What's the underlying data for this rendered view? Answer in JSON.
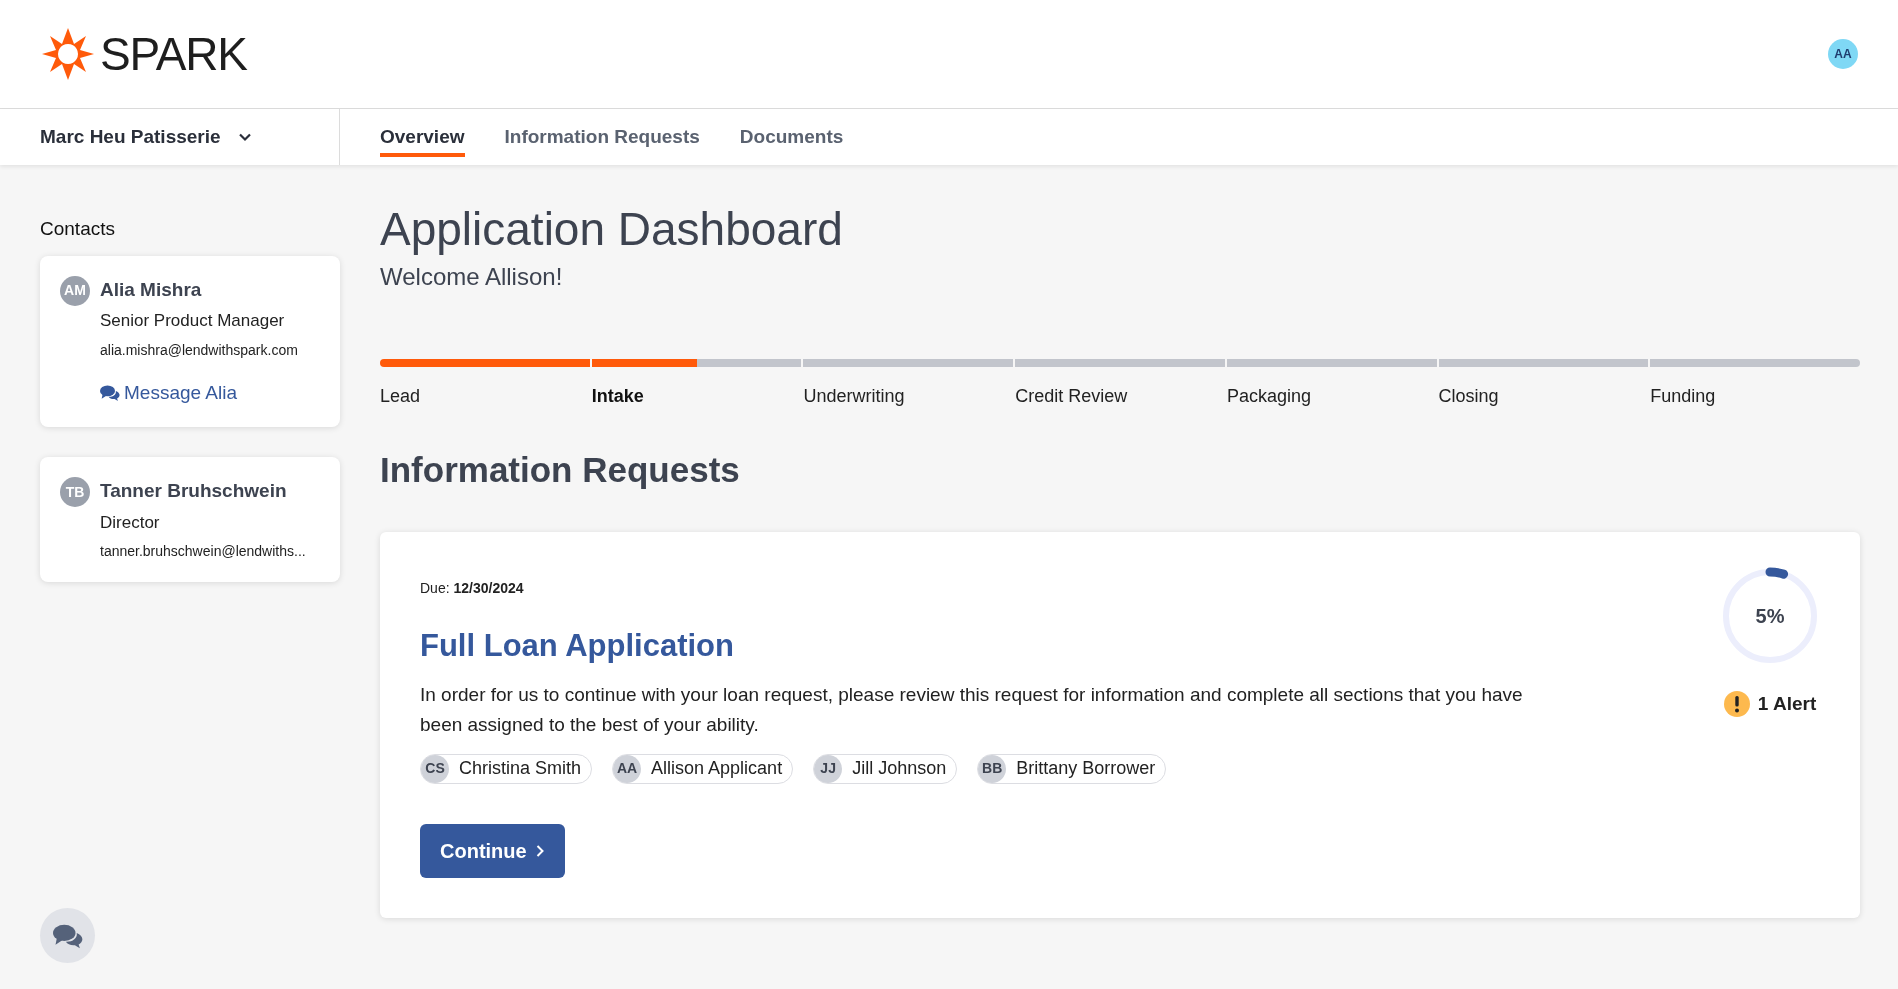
{
  "header": {
    "logo": "SPARK",
    "user_initials": "AA"
  },
  "business_selector": {
    "label": "Marc Heu Patisserie"
  },
  "tabs": [
    {
      "label": "Overview",
      "selected": true
    },
    {
      "label": "Information Requests",
      "selected": false
    },
    {
      "label": "Documents",
      "selected": false
    }
  ],
  "contacts": {
    "title": "Contacts",
    "items": [
      {
        "initials": "AM",
        "name": "Alia Mishra",
        "role": "Senior Product Manager",
        "email": "alia.mishra@lendwithspark.com",
        "message_link": "Message Alia"
      },
      {
        "initials": "TB",
        "name": "Tanner Bruhschwein",
        "role": "Director",
        "email": "tanner.bruhschwein@lendwiths..."
      }
    ]
  },
  "dashboard": {
    "title": "Application Dashboard",
    "subtitle": "Welcome Allison!"
  },
  "stages": [
    {
      "label": "Lead",
      "level": 1,
      "selected": false
    },
    {
      "label": "Intake",
      "level": 0.5,
      "selected": true
    },
    {
      "label": "Underwriting",
      "level": 0,
      "selected": false
    },
    {
      "label": "Credit Review",
      "level": 0,
      "selected": false
    },
    {
      "label": "Packaging",
      "level": 0,
      "selected": false
    },
    {
      "label": "Closing",
      "level": 0,
      "selected": false
    },
    {
      "label": "Funding",
      "level": 0,
      "selected": false
    }
  ],
  "information_requests": {
    "title": "Information Requests",
    "items": [
      {
        "due": "Due: **12/30/2024**",
        "title": "Full Loan Application",
        "description": "In order for us to continue with your loan request, please review this request for information and complete all sections that you have been assigned to the best of your ability.",
        "assignees": [
          {
            "initials": "CS",
            "name": "Christina Smith"
          },
          {
            "initials": "AA",
            "name": "Allison Applicant"
          },
          {
            "initials": "JJ",
            "name": "Jill Johnson"
          },
          {
            "initials": "BB",
            "name": "Brittany Borrower"
          }
        ],
        "button": "Continue",
        "progress": {
          "level": 0.05,
          "reading": "5%"
        },
        "alert": "1 Alert"
      }
    ]
  }
}
